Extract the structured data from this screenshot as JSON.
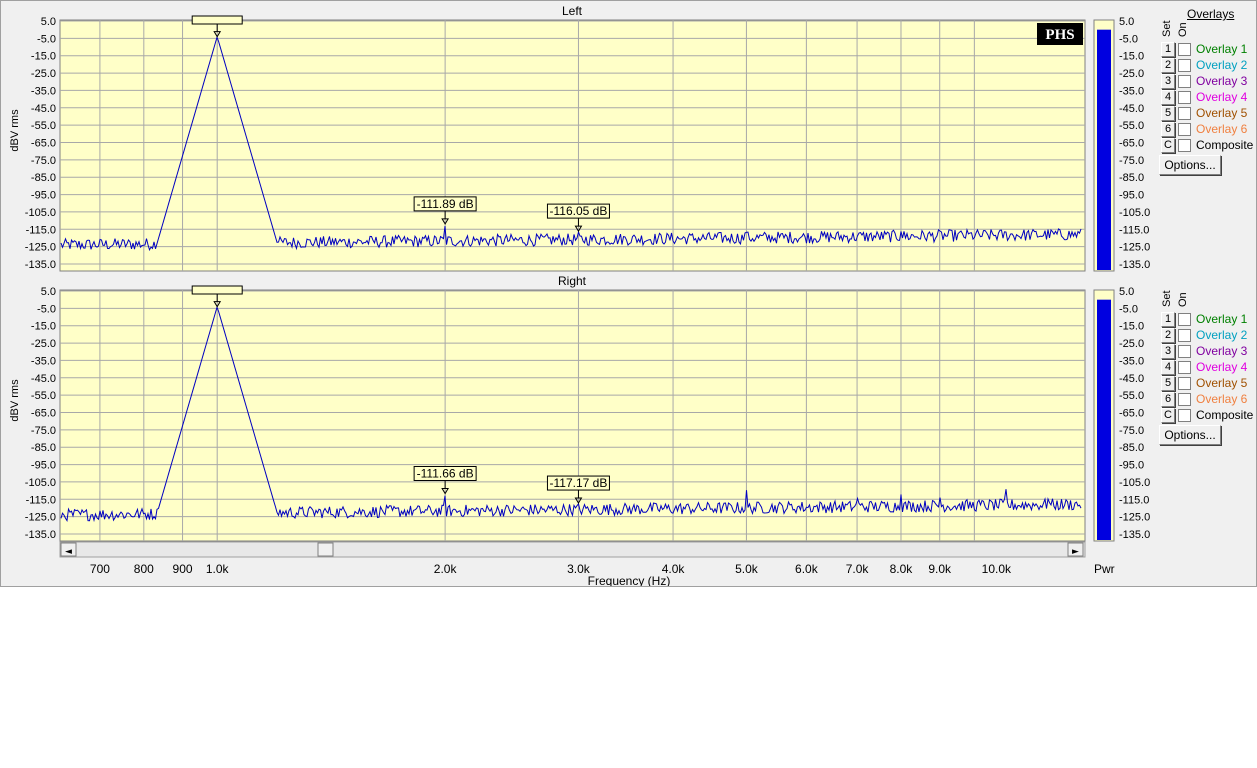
{
  "colors": {
    "plot_bg": "#ffffc8",
    "trace": "#0000c0",
    "grid": "#a8a8a8",
    "meter": "#0000e0"
  },
  "logo": "PHS",
  "x_axis_label": "Frequency (Hz)",
  "x_ticks": [
    "700",
    "800",
    "900",
    "1.0k",
    "2.0k",
    "3.0k",
    "4.0k",
    "5.0k",
    "6.0k",
    "7.0k",
    "8.0k",
    "9.0k",
    "10.0k"
  ],
  "y_ticks": [
    "5.0",
    "-5.0",
    "-15.0",
    "-25.0",
    "-35.0",
    "-45.0",
    "-55.0",
    "-65.0",
    "-75.0",
    "-85.0",
    "-95.0",
    "-105.0",
    "-115.0",
    "-125.0",
    "-135.0"
  ],
  "meter_ticks": [
    "5.0",
    "-5.0",
    "-15.0",
    "-25.0",
    "-35.0",
    "-45.0",
    "-55.0",
    "-65.0",
    "-75.0",
    "-85.0",
    "-95.0",
    "-105.0",
    "-115.0",
    "-125.0",
    "-135.0"
  ],
  "meter_label": "Pwr",
  "scroll_left_glyph": "◄",
  "scroll_right_glyph": "►",
  "overlays_title": "Overlays",
  "set_label": "Set",
  "on_label": "On",
  "options_label": "Options...",
  "overlays": [
    {
      "key": "1",
      "name": "Overlay 1",
      "color": "#008000"
    },
    {
      "key": "2",
      "name": "Overlay 2",
      "color": "#00a0c0"
    },
    {
      "key": "3",
      "name": "Overlay 3",
      "color": "#8000a0"
    },
    {
      "key": "4",
      "name": "Overlay 4",
      "color": "#e000e0"
    },
    {
      "key": "5",
      "name": "Overlay 5",
      "color": "#a05000"
    },
    {
      "key": "6",
      "name": "Overlay 6",
      "color": "#f08040"
    },
    {
      "key": "C",
      "name": "Composite",
      "color": "#000000"
    }
  ],
  "chart_data": [
    {
      "type": "line",
      "title": "Left",
      "ylabel": "dBV rms",
      "xlabel": "Frequency (Hz)",
      "x_scale": "log",
      "xlim": [
        620,
        14000
      ],
      "ylim": [
        -140,
        5
      ],
      "grid": true,
      "noise_floor_db": -124,
      "meter_level_db": 0,
      "peaks": [
        {
          "freq": 1000,
          "level_db": -4,
          "label": ""
        },
        {
          "freq": 2000,
          "level_db": -111.89,
          "label": "-111.89 dB"
        },
        {
          "freq": 3000,
          "level_db": -116.05,
          "label": "-116.05 dB"
        },
        {
          "freq": 5000,
          "level_db": -116,
          "label": ""
        },
        {
          "freq": 8000,
          "level_db": -116,
          "label": ""
        }
      ]
    },
    {
      "type": "line",
      "title": "Right",
      "ylabel": "dBV rms",
      "xlabel": "Frequency (Hz)",
      "x_scale": "log",
      "xlim": [
        620,
        14000
      ],
      "ylim": [
        -140,
        5
      ],
      "grid": true,
      "noise_floor_db": -124,
      "meter_level_db": 0,
      "peaks": [
        {
          "freq": 1000,
          "level_db": -4,
          "label": ""
        },
        {
          "freq": 2000,
          "level_db": -111.66,
          "label": "-111.66 dB"
        },
        {
          "freq": 3000,
          "level_db": -117.17,
          "label": "-117.17 dB"
        },
        {
          "freq": 5000,
          "level_db": -109,
          "label": ""
        },
        {
          "freq": 7000,
          "level_db": -110,
          "label": ""
        },
        {
          "freq": 8000,
          "level_db": -112,
          "label": ""
        },
        {
          "freq": 9000,
          "level_db": -111,
          "label": ""
        },
        {
          "freq": 11000,
          "level_db": -106,
          "label": ""
        },
        {
          "freq": 12500,
          "level_db": -112,
          "label": ""
        }
      ]
    }
  ]
}
